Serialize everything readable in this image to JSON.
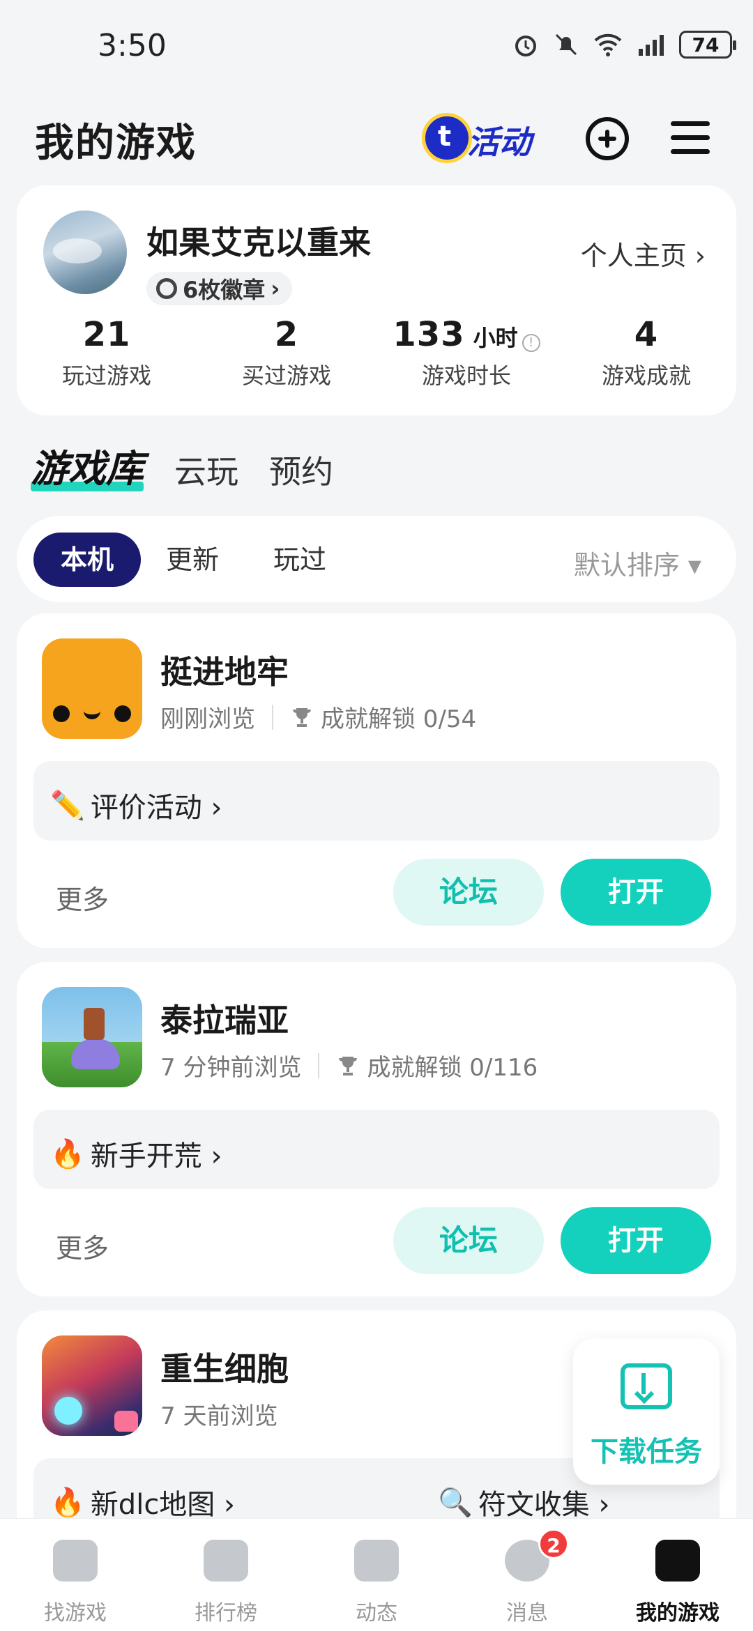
{
  "status_bar": {
    "time": "3:50",
    "battery": "74"
  },
  "header": {
    "title": "我的游戏",
    "activity_label": "活动"
  },
  "profile": {
    "username": "如果艾克以重来",
    "badges": "6枚徽章",
    "home_link": "个人主页 ›",
    "stats": [
      {
        "value": "21",
        "unit": "",
        "label": "玩过游戏"
      },
      {
        "value": "2",
        "unit": "",
        "label": "买过游戏"
      },
      {
        "value": "133",
        "unit": "小时",
        "label": "游戏时长"
      },
      {
        "value": "4",
        "unit": "",
        "label": "游戏成就"
      }
    ]
  },
  "library_tabs": [
    "游戏库",
    "云玩",
    "预约"
  ],
  "filters": {
    "chips": [
      "本机",
      "更新",
      "玩过"
    ],
    "sort": "默认排序 ▾"
  },
  "games": [
    {
      "title": "挺进地牢",
      "viewed": "刚刚浏览",
      "achievements": "成就解锁 0/54",
      "events": [
        "评价活动 ›"
      ],
      "more": "更多",
      "forum": "论坛",
      "open": "打开"
    },
    {
      "title": "泰拉瑞亚",
      "viewed": "7 分钟前浏览",
      "achievements": "成就解锁 0/116",
      "events": [
        "新手开荒 ›"
      ],
      "more": "更多",
      "forum": "论坛",
      "open": "打开"
    },
    {
      "title": "重生细胞",
      "viewed": "7 天前浏览",
      "events": [
        "新dlc地图 ›",
        "符文收集 ›"
      ]
    }
  ],
  "download_fab": {
    "label": "下载任务"
  },
  "bottom_nav": [
    {
      "label": "找游戏"
    },
    {
      "label": "排行榜"
    },
    {
      "label": "动态"
    },
    {
      "label": "消息",
      "badge": "2"
    },
    {
      "label": "我的游戏"
    }
  ],
  "colors": {
    "accent": "#14d1bd",
    "chip_active": "#1a1b6e",
    "badge_red": "#f23b3b"
  }
}
